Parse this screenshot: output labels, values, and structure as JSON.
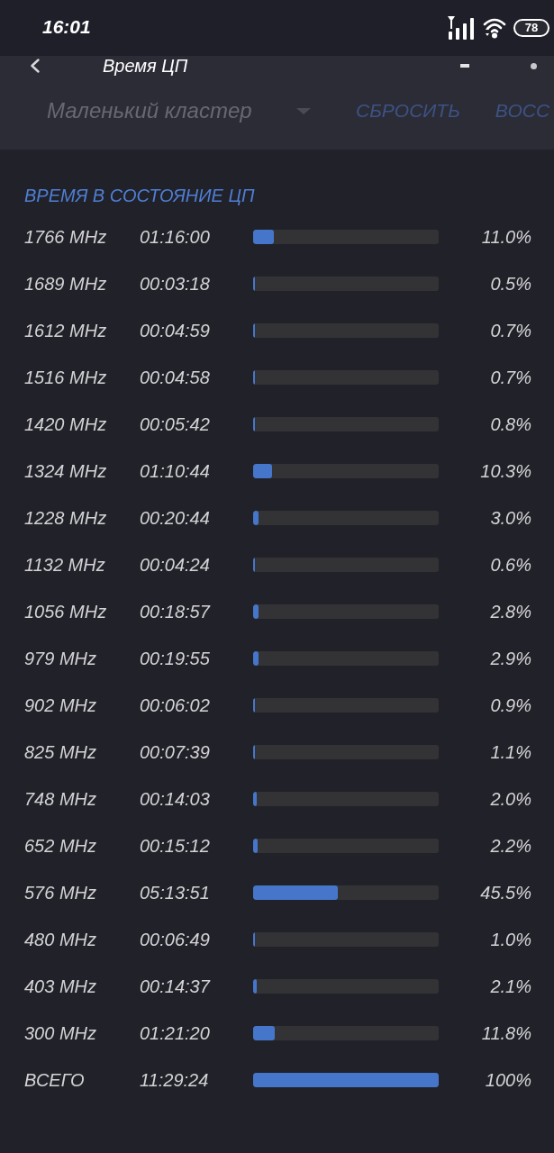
{
  "status_bar": {
    "time": "16:01",
    "battery": "78"
  },
  "app_bar": {
    "title": "Время ЦП"
  },
  "toolbar": {
    "cluster": "Маленький кластер",
    "buttons": [
      "СБРОСИТЬ",
      "ВОСС"
    ]
  },
  "section": {
    "title": "ВРЕМЯ В СОСТОЯНИЕ ЦП",
    "rows": [
      {
        "frequency": "1766 MHz",
        "time": "01:16:00",
        "level": 0.11,
        "percent": "11.0%"
      },
      {
        "frequency": "1689 MHz",
        "time": "00:03:18",
        "level": 0.005,
        "percent": "0.5%"
      },
      {
        "frequency": "1612 MHz",
        "time": "00:04:59",
        "level": 0.007,
        "percent": "0.7%"
      },
      {
        "frequency": "1516 MHz",
        "time": "00:04:58",
        "level": 0.007,
        "percent": "0.7%"
      },
      {
        "frequency": "1420 MHz",
        "time": "00:05:42",
        "level": 0.008,
        "percent": "0.8%"
      },
      {
        "frequency": "1324 MHz",
        "time": "01:10:44",
        "level": 0.103,
        "percent": "10.3%"
      },
      {
        "frequency": "1228 MHz",
        "time": "00:20:44",
        "level": 0.03,
        "percent": "3.0%"
      },
      {
        "frequency": "1132 MHz",
        "time": "00:04:24",
        "level": 0.006,
        "percent": "0.6%"
      },
      {
        "frequency": "1056 MHz",
        "time": "00:18:57",
        "level": 0.028,
        "percent": "2.8%"
      },
      {
        "frequency": "979 MHz",
        "time": "00:19:55",
        "level": 0.029,
        "percent": "2.9%"
      },
      {
        "frequency": "902 MHz",
        "time": "00:06:02",
        "level": 0.009,
        "percent": "0.9%"
      },
      {
        "frequency": "825 MHz",
        "time": "00:07:39",
        "level": 0.011,
        "percent": "1.1%"
      },
      {
        "frequency": "748 MHz",
        "time": "00:14:03",
        "level": 0.02,
        "percent": "2.0%"
      },
      {
        "frequency": "652 MHz",
        "time": "00:15:12",
        "level": 0.022,
        "percent": "2.2%"
      },
      {
        "frequency": "576 MHz",
        "time": "05:13:51",
        "level": 0.455,
        "percent": "45.5%"
      },
      {
        "frequency": "480 MHz",
        "time": "00:06:49",
        "level": 0.01,
        "percent": "1.0%"
      },
      {
        "frequency": "403 MHz",
        "time": "00:14:37",
        "level": 0.021,
        "percent": "2.1%"
      },
      {
        "frequency": "300 MHz",
        "time": "01:21:20",
        "level": 0.118,
        "percent": "11.8%"
      },
      {
        "frequency": "ВСЕГО",
        "time": "11:29:24",
        "level": 1,
        "percent": "100%"
      }
    ]
  }
}
